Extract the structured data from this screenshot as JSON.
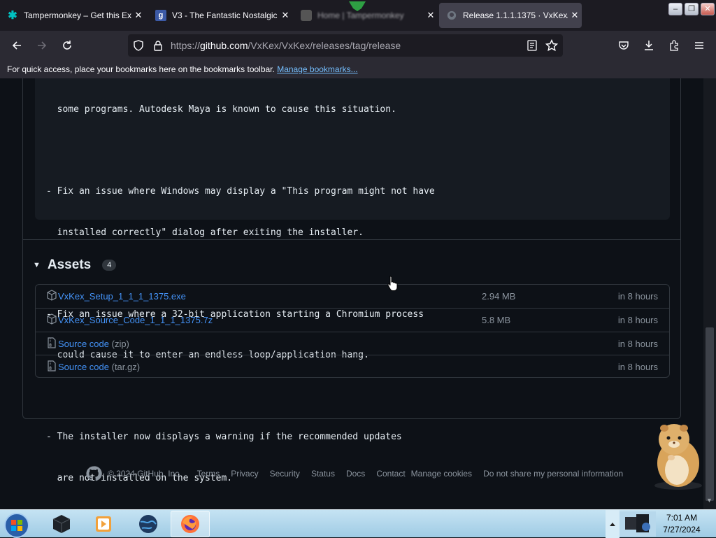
{
  "browser": {
    "tabs": [
      {
        "title": "Tampermonkey – Get this Ex",
        "active": false,
        "blurred": false
      },
      {
        "title": "V3 - The Fantastic Nostalgic",
        "active": false,
        "blurred": false
      },
      {
        "title": "Home | Tampermonkey",
        "active": false,
        "blurred": true
      },
      {
        "title": "Release 1.1.1.1375 · VxKex/Vx",
        "active": true,
        "blurred": false
      }
    ],
    "url": {
      "prefix": "https://",
      "host": "github.com",
      "path": "/VxKex/VxKex/releases/tag/release"
    },
    "bookmarks_bar": {
      "text": "For quick access, place your bookmarks here on the bookmarks toolbar.",
      "link": "Manage bookmarks..."
    }
  },
  "release_notes": {
    "lines": [
      "  some programs. Autodesk Maya is known to cause this situation.",
      "",
      "- Fix an issue where Windows may display a \"This program might not have",
      "  installed correctly\" dialog after exiting the installer.",
      "",
      "- Fix an issue where a 32-bit application starting a Chromium process",
      "  could cause it to enter an endless loop/application hang.",
      "",
      "- The installer now displays a warning if the recommended updates",
      "  are not installed on the system."
    ]
  },
  "assets": {
    "title": "Assets",
    "count": "4",
    "items": [
      {
        "name": "VxKex_Setup_1_1_1_1375.exe",
        "sub": "",
        "size": "2.94 MB",
        "time": "in 8 hours",
        "icon": "package-icon"
      },
      {
        "name": "VxKex_Source_Code_1_1_1_1375.7z",
        "sub": "",
        "size": "5.8 MB",
        "time": "in 8 hours",
        "icon": "package-icon"
      },
      {
        "name": "Source code",
        "sub": " (zip)",
        "size": "",
        "time": "in 8 hours",
        "icon": "file-zip-icon"
      },
      {
        "name": "Source code",
        "sub": " (tar.gz)",
        "size": "",
        "time": "in 8 hours",
        "icon": "file-zip-icon"
      }
    ]
  },
  "footer": {
    "copyright": "© 2024 GitHub, Inc.",
    "links": [
      "Terms",
      "Privacy",
      "Security",
      "Status",
      "Docs",
      "Contact",
      "Manage cookies",
      "Do not share my personal information"
    ]
  },
  "taskbar": {
    "time": "7:01 AM",
    "date": "7/27/2024"
  }
}
